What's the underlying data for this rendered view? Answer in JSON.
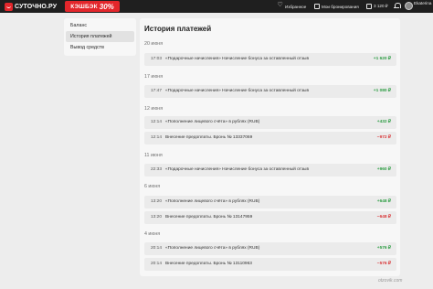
{
  "header": {
    "logo_text": "СУТОЧНО.РУ",
    "cashback_label": "КЭШБЭК",
    "cashback_value": "30%",
    "nav": [
      {
        "label": "Избранное",
        "icon": "heart-icon"
      },
      {
        "label": "Мои бронирования",
        "icon": "calendar-icon"
      },
      {
        "label": "3 120 ₽",
        "icon": "wallet-icon"
      }
    ],
    "user_name": "Ekaterina"
  },
  "sidebar": {
    "items": [
      {
        "label": "Баланс"
      },
      {
        "label": "История платежей",
        "active": true
      },
      {
        "label": "Вывод средств"
      }
    ]
  },
  "main": {
    "title": "История платежей",
    "groups": [
      {
        "date": "20 июня",
        "rows": [
          {
            "time": "17:03",
            "desc": "«Подарочные начисления» Начисление бонуса за оставленный отзыв",
            "amount": "+1 620 ₽",
            "sign": "pos"
          }
        ]
      },
      {
        "date": "17 июня",
        "rows": [
          {
            "time": "17:47",
            "desc": "«Подарочные начисления» Начисление бонуса за оставленный отзыв",
            "amount": "+1 080 ₽",
            "sign": "pos"
          }
        ]
      },
      {
        "date": "12 июня",
        "rows": [
          {
            "time": "12:14",
            "desc": "«Пополнение лицевого счёта» в рублях (RUB)",
            "amount": "+432 ₽",
            "sign": "pos"
          },
          {
            "time": "12:14",
            "desc": "Внесение предоплаты. Бронь № 13337069",
            "amount": "−972 ₽",
            "sign": "neg"
          }
        ]
      },
      {
        "date": "11 июня",
        "rows": [
          {
            "time": "22:33",
            "desc": "«Подарочные начисления» Начисление бонуса за оставленный отзыв",
            "amount": "+960 ₽",
            "sign": "pos"
          }
        ]
      },
      {
        "date": "6 июня",
        "rows": [
          {
            "time": "13:20",
            "desc": "«Пополнение лицевого счёта» в рублях (RUB)",
            "amount": "+648 ₽",
            "sign": "pos"
          },
          {
            "time": "13:20",
            "desc": "Внесение предоплаты. Бронь № 13147959",
            "amount": "−648 ₽",
            "sign": "neg"
          }
        ]
      },
      {
        "date": "4 июня",
        "rows": [
          {
            "time": "20:14",
            "desc": "«Пополнение лицевого счёта» в рублях (RUB)",
            "amount": "+576 ₽",
            "sign": "pos"
          },
          {
            "time": "20:14",
            "desc": "Внесение предоплаты. Бронь № 13110963",
            "amount": "−576 ₽",
            "sign": "neg"
          }
        ]
      }
    ]
  },
  "watermark": "otzovik.com",
  "colors": {
    "header_bg": "#1f1f1f",
    "brand_red": "#e3262b",
    "positive": "#2f9e45",
    "negative": "#d9383a"
  }
}
